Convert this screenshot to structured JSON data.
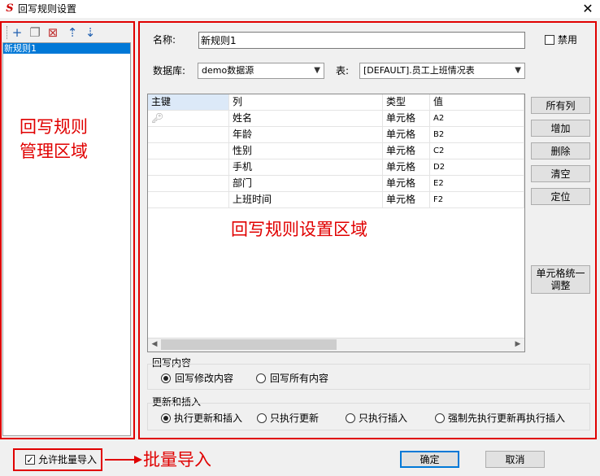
{
  "window": {
    "title": "回写规则设置",
    "app_icon": "S",
    "close_glyph": "✕"
  },
  "left_panel": {
    "toolbar": [
      {
        "name": "add-icon",
        "glyph": "+"
      },
      {
        "name": "copy-icon",
        "glyph": "❐"
      },
      {
        "name": "delete-icon",
        "glyph": "⊠"
      },
      {
        "name": "move-up-icon",
        "glyph": "⇡"
      },
      {
        "name": "move-down-icon",
        "glyph": "⇣"
      }
    ],
    "rules": [
      "新规则1"
    ],
    "annotation": [
      "回写规则",
      "管理区域"
    ]
  },
  "form": {
    "name_label": "名称:",
    "name_value": "新规则1",
    "disable_label": "禁用",
    "db_label": "数据库:",
    "db_value": "demo数据源",
    "table_label": "表:",
    "table_value": "[DEFAULT].员工上班情况表"
  },
  "grid": {
    "headers": [
      "主键",
      "列",
      "类型",
      "值"
    ],
    "rows": [
      {
        "col": "姓名",
        "type": "单元格",
        "value": "A2"
      },
      {
        "col": "年龄",
        "type": "单元格",
        "value": "B2"
      },
      {
        "col": "性别",
        "type": "单元格",
        "value": "C2"
      },
      {
        "col": "手机",
        "type": "单元格",
        "value": "D2"
      },
      {
        "col": "部门",
        "type": "单元格",
        "value": "E2"
      },
      {
        "col": "上班时间",
        "type": "单元格",
        "value": "F2"
      }
    ],
    "annotation": "回写规则设置区域"
  },
  "side_buttons": {
    "all_columns": "所有列",
    "add": "增加",
    "delete": "删除",
    "clear": "清空",
    "locate": "定位",
    "unify": [
      "单元格统一",
      "调整"
    ]
  },
  "writeback_group": {
    "title": "回写内容",
    "options": [
      "回写修改内容",
      "回写所有内容"
    ],
    "selected": 0
  },
  "update_group": {
    "title": "更新和插入",
    "options": [
      "执行更新和插入",
      "只执行更新",
      "只执行插入",
      "强制先执行更新再执行插入"
    ],
    "selected": 0
  },
  "footer": {
    "batch_import_label": "允许批量导入",
    "batch_import_checked": true,
    "annotation": "批量导入",
    "ok": "确定",
    "cancel": "取消"
  },
  "colors": {
    "annotation": "#e00000",
    "selection": "#0078d7",
    "key_header": "#dce9f8"
  }
}
